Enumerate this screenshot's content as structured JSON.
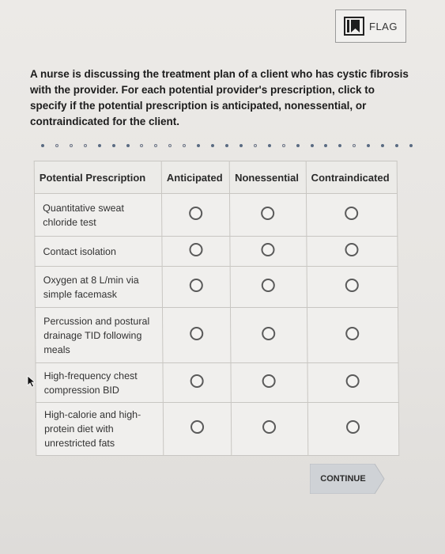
{
  "flag": {
    "label": "FLAG",
    "icon": "bookmark-flag-icon"
  },
  "prompt": "A nurse is discussing the treatment plan of a client who has cystic fibrosis with the provider. For each potential provider's prescription, click to specify if the potential prescription is anticipated, nonessential, or contraindicated for the client.",
  "table": {
    "headers": [
      "Potential Prescription",
      "Anticipated",
      "Nonessential",
      "Contraindicated"
    ],
    "rows": [
      {
        "label": "Quantitative sweat chloride test"
      },
      {
        "label": "Contact isolation"
      },
      {
        "label": "Oxygen at 8 L/min via simple facemask"
      },
      {
        "label": "Percussion and postural drainage TID following meals"
      },
      {
        "label": "High-frequency chest compression BID"
      },
      {
        "label": "High-calorie and high-protein diet with unrestricted fats"
      }
    ]
  },
  "continue": {
    "label": "CONTINUE"
  },
  "colors": {
    "accent": "#5a6b82",
    "background": "#e8e6e3",
    "button": "#cfd2d6"
  }
}
